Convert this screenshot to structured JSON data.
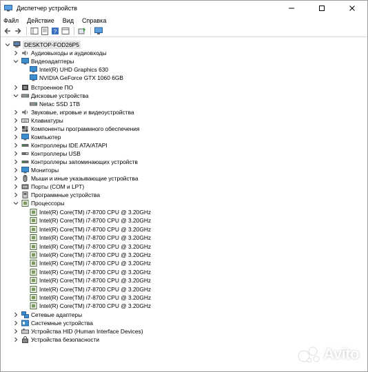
{
  "window": {
    "title": "Диспетчер устройств"
  },
  "menu": {
    "file": "Файл",
    "action": "Действие",
    "view": "Вид",
    "help": "Справка"
  },
  "tree": {
    "root": "DESKTOP-FOD26P5",
    "audio": "Аудиовыходы и аудиовходы",
    "video": "Видеоадаптеры",
    "gpu1": "Intel(R) UHD Graphics 630",
    "gpu2": "NVIDIA GeForce GTX 1060 6GB",
    "firmware": "Встроенное ПО",
    "disks": "Дисковые устройства",
    "disk1": "Netac SSD 1TB",
    "sound": "Звуковые, игровые и видеоустройства",
    "keyboards": "Клавиатуры",
    "software": "Компоненты программного обеспечения",
    "computer": "Компьютер",
    "ide": "Контроллеры IDE ATA/ATAPI",
    "usb": "Контроллеры USB",
    "storage": "Контроллеры запоминающих устройств",
    "monitors": "Мониторы",
    "mice": "Мыши и иные указывающие устройства",
    "ports": "Порты (COM и LPT)",
    "swdev": "Программные устройства",
    "cpus": "Процессоры",
    "cpu_items": [
      "Intel(R) Core(TM) i7-8700 CPU @ 3.20GHz",
      "Intel(R) Core(TM) i7-8700 CPU @ 3.20GHz",
      "Intel(R) Core(TM) i7-8700 CPU @ 3.20GHz",
      "Intel(R) Core(TM) i7-8700 CPU @ 3.20GHz",
      "Intel(R) Core(TM) i7-8700 CPU @ 3.20GHz",
      "Intel(R) Core(TM) i7-8700 CPU @ 3.20GHz",
      "Intel(R) Core(TM) i7-8700 CPU @ 3.20GHz",
      "Intel(R) Core(TM) i7-8700 CPU @ 3.20GHz",
      "Intel(R) Core(TM) i7-8700 CPU @ 3.20GHz",
      "Intel(R) Core(TM) i7-8700 CPU @ 3.20GHz",
      "Intel(R) Core(TM) i7-8700 CPU @ 3.20GHz",
      "Intel(R) Core(TM) i7-8700 CPU @ 3.20GHz"
    ],
    "network": "Сетевые адаптеры",
    "system": "Системные устройства",
    "hid": "Устройства HID (Human Interface Devices)",
    "security": "Устройства безопасности"
  },
  "watermark": {
    "text": "Avito"
  }
}
